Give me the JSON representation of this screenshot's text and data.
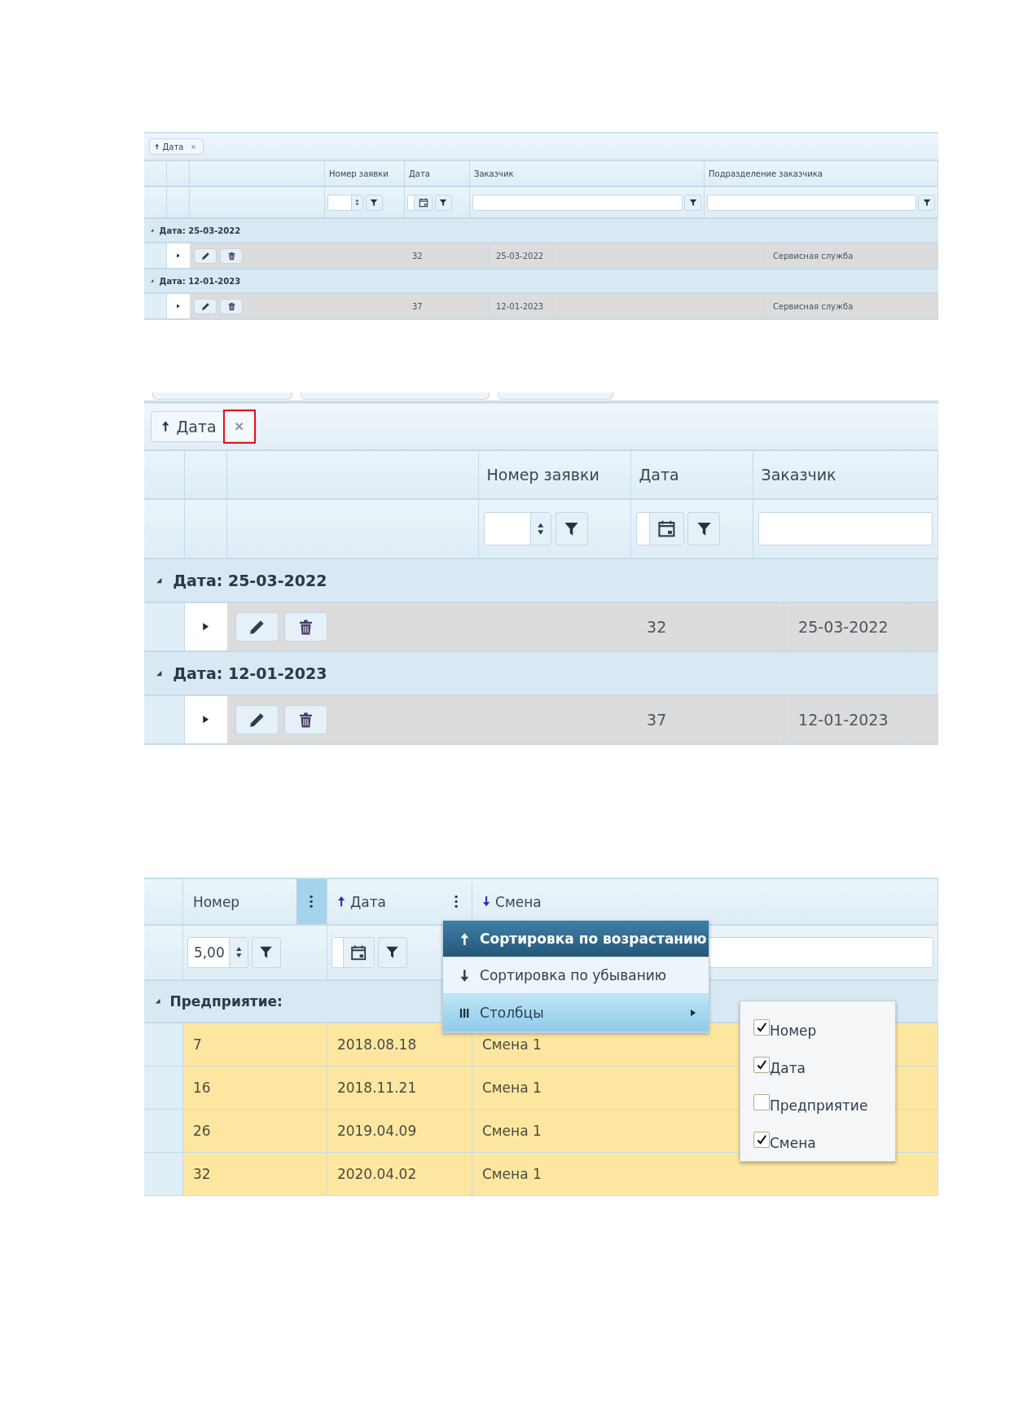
{
  "figures": [
    {
      "kind": "grouped_grid",
      "grouping_chip": {
        "label": "Дата",
        "sorted": true,
        "descending": false,
        "close_marked": false
      },
      "columns": [
        "Номер заявки",
        "Дата",
        "Заказчик",
        "Подразделение заказчика"
      ],
      "filters": [
        {
          "kind": "number"
        },
        {
          "kind": "date"
        },
        {
          "kind": "text",
          "filter_button": true
        },
        {
          "kind": "text",
          "filter_button": true
        }
      ],
      "groups": [
        {
          "label": "Дата: 25-03-2022",
          "expanded": true,
          "rows": [
            {
              "expanded": false,
              "number": "32",
              "date": "25-03-2022",
              "department": "Сервисная служба"
            }
          ]
        },
        {
          "label": "Дата: 12-01-2023",
          "expanded": true,
          "rows": [
            {
              "expanded": false,
              "number": "37",
              "date": "12-01-2023",
              "department": "Сервисная служба"
            }
          ]
        }
      ]
    },
    {
      "kind": "grouped_grid",
      "top_tabs": true,
      "grouping_chip": {
        "label": "Дата",
        "sorted": true,
        "descending": false,
        "close_marked": true
      },
      "columns": [
        "Номер заявки",
        "Дата",
        "Заказчик"
      ],
      "filters": [
        {
          "kind": "number"
        },
        {
          "kind": "date"
        },
        {
          "kind": "text",
          "filter_button": false
        }
      ],
      "groups": [
        {
          "label": "Дата: 25-03-2022",
          "expanded": true,
          "rows": [
            {
              "expanded": false,
              "number": "32",
              "date": "25-03-2022"
            }
          ]
        },
        {
          "label": "Дата: 12-01-2023",
          "expanded": true,
          "rows": [
            {
              "expanded": false,
              "number": "37",
              "date": "12-01-2023"
            }
          ]
        }
      ]
    },
    {
      "kind": "grid_with_menu",
      "columns": [
        {
          "label": "Номер",
          "sorted": false,
          "menu_active": true
        },
        {
          "label": "Дата",
          "sorted": true,
          "descending": false,
          "menu_active": false
        },
        {
          "label": "Смена",
          "sorted": true,
          "descending": true
        }
      ],
      "filters": [
        {
          "kind": "number",
          "value": "5,00"
        },
        {
          "kind": "date"
        },
        {
          "kind": "text"
        }
      ],
      "group": {
        "label": "Предприятие:",
        "expanded": true
      },
      "rows": [
        [
          "7",
          "2018.08.18",
          "Смена 1"
        ],
        [
          "16",
          "2018.11.21",
          "Смена 1"
        ],
        [
          "26",
          "2019.04.09",
          "Смена 1"
        ],
        [
          "32",
          "2020.04.02",
          "Смена 1"
        ]
      ],
      "context_menu": [
        {
          "kind": "sort_asc",
          "label": "Сортировка по возрастанию",
          "selected": true
        },
        {
          "kind": "sort_desc",
          "label": "Сортировка по убыванию",
          "selected": false
        },
        {
          "kind": "submenu",
          "label": "Столбцы",
          "selected": false,
          "expanded": true
        }
      ],
      "submenu": [
        {
          "label": "Номер",
          "checked": true
        },
        {
          "label": "Дата",
          "checked": true
        },
        {
          "label": "Предприятие",
          "checked": false
        },
        {
          "label": "Смена",
          "checked": true
        }
      ]
    }
  ]
}
